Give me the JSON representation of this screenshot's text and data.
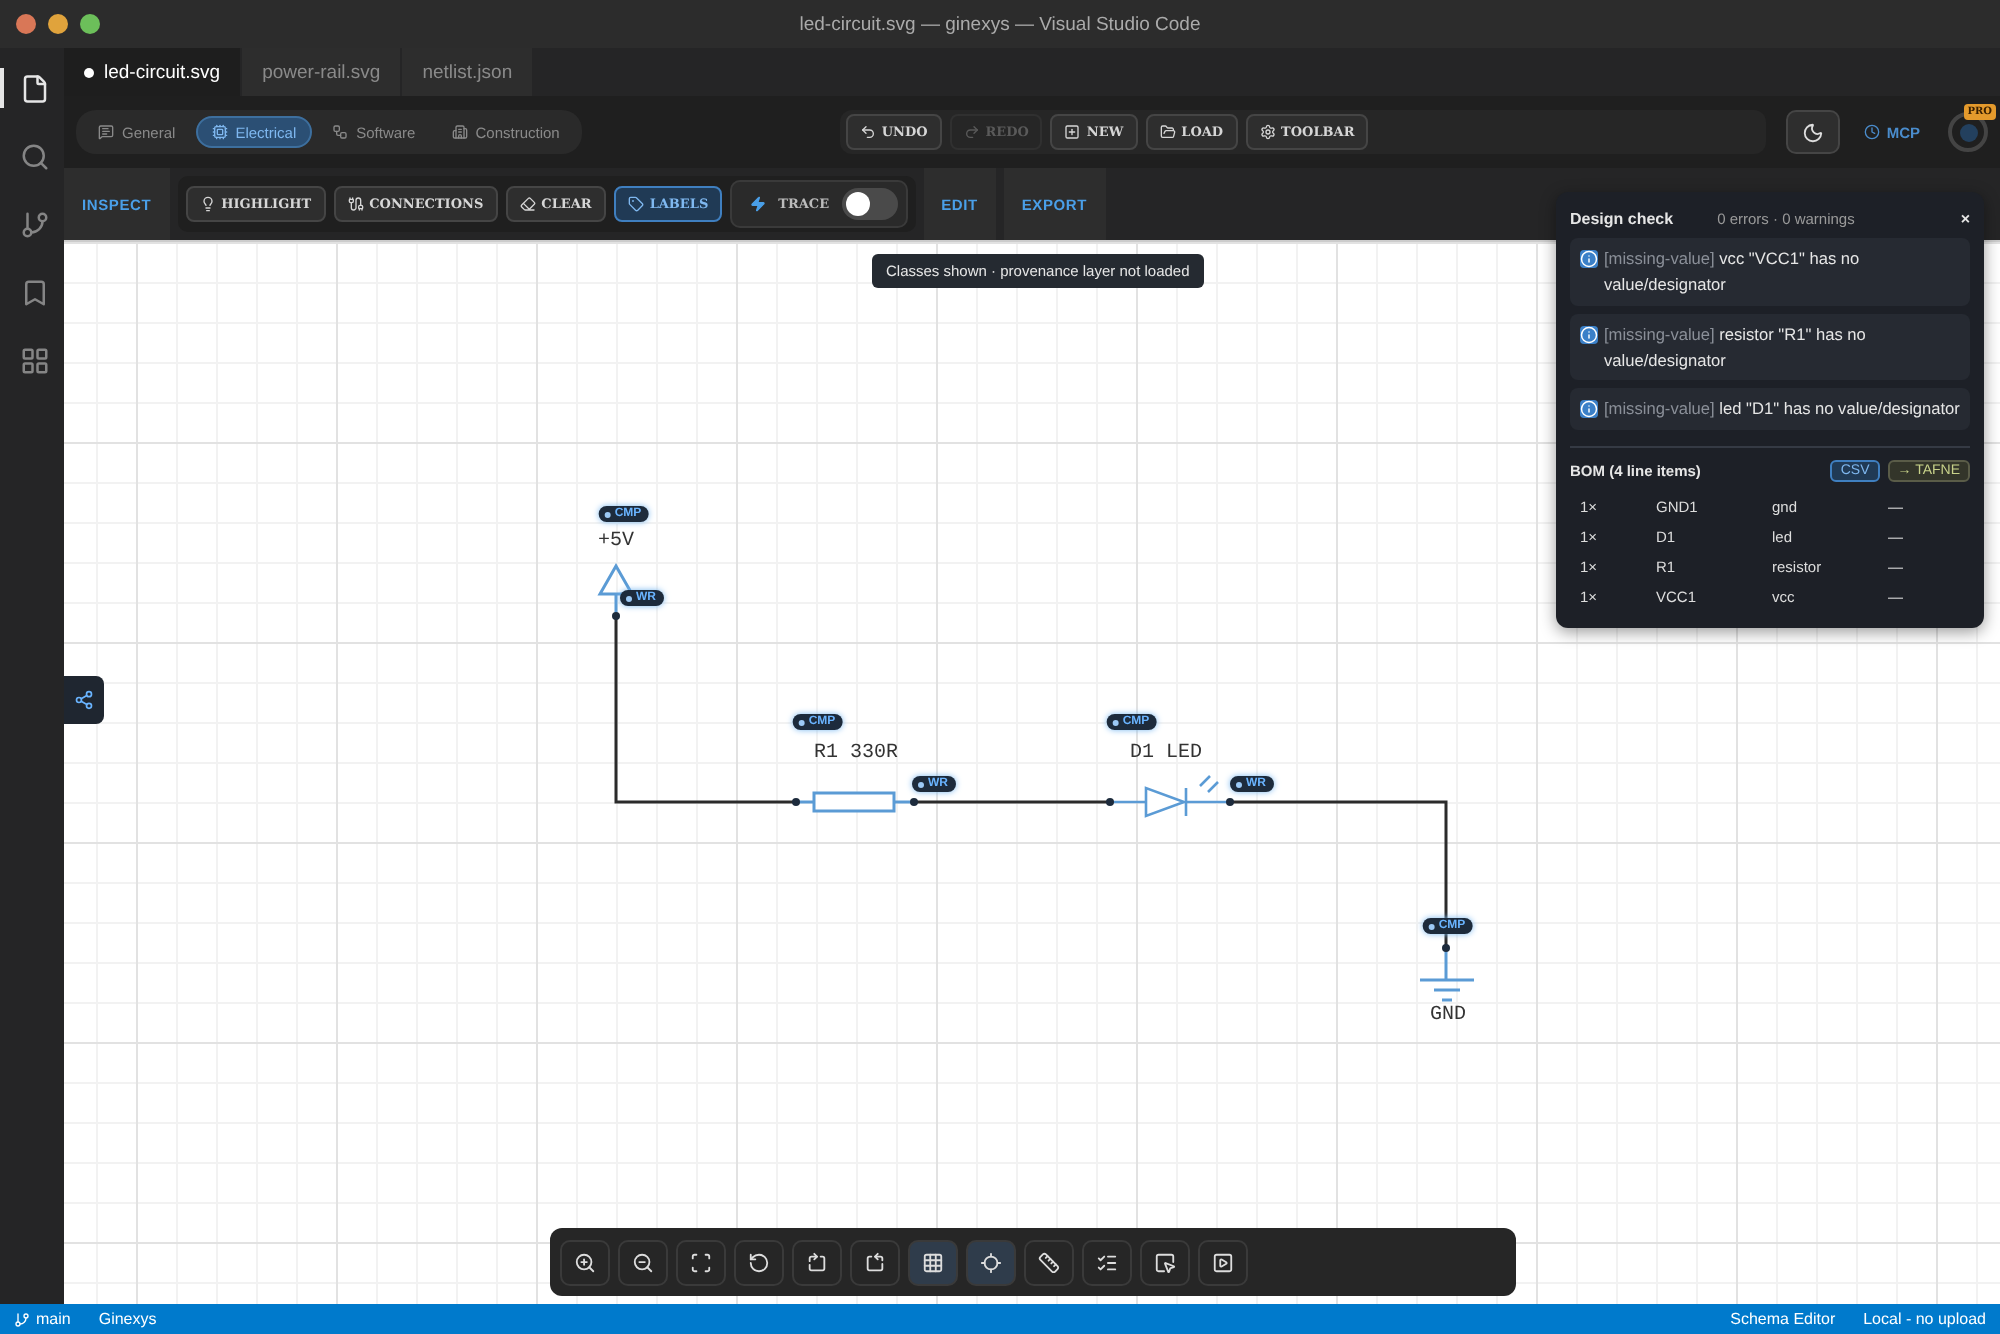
{
  "window": {
    "title": "led-circuit.svg — ginexys — Visual Studio Code"
  },
  "activity_bar": [
    {
      "kind": "files",
      "selected": true
    },
    {
      "kind": "search",
      "selected": false
    },
    {
      "kind": "source-control",
      "selected": false
    },
    {
      "kind": "bookmarks",
      "selected": false
    },
    {
      "kind": "extensions",
      "selected": false
    }
  ],
  "tabs": [
    {
      "label": "led-circuit.svg",
      "selected": true,
      "modified": true
    },
    {
      "label": "power-rail.svg",
      "selected": false,
      "modified": false
    },
    {
      "label": "netlist.json",
      "selected": false,
      "modified": false
    }
  ],
  "categories": [
    {
      "kind": "general",
      "label": "General",
      "selected": false
    },
    {
      "kind": "electrical",
      "label": "Electrical",
      "selected": true
    },
    {
      "kind": "software",
      "label": "Software",
      "selected": false
    },
    {
      "kind": "construction",
      "label": "Construction",
      "selected": false
    }
  ],
  "actions": [
    {
      "kind": "undo",
      "label": "UNDO",
      "disabled": false
    },
    {
      "kind": "redo",
      "label": "REDO",
      "disabled": true
    },
    {
      "kind": "new",
      "label": "NEW",
      "disabled": false
    },
    {
      "kind": "load",
      "label": "LOAD",
      "disabled": false
    },
    {
      "kind": "toolbar",
      "label": "TOOLBAR",
      "disabled": false
    }
  ],
  "mcp": {
    "label": "MCP"
  },
  "avatar": {
    "badge": "PRO"
  },
  "sections": [
    {
      "label": "INSPECT"
    },
    {
      "label": "EDIT"
    },
    {
      "label": "EXPORT"
    }
  ],
  "inspect_tools": [
    {
      "kind": "highlight",
      "label": "HIGHLIGHT",
      "selected": false
    },
    {
      "kind": "connections",
      "label": "CONNECTIONS",
      "selected": false
    },
    {
      "kind": "clear",
      "label": "CLEAR",
      "selected": false
    },
    {
      "kind": "labels",
      "label": "LABELS",
      "selected": true
    }
  ],
  "trace": {
    "label": "TRACE",
    "on": false
  },
  "tooltip": "Classes shown · provenance layer not loaded",
  "schematic": {
    "components": [
      {
        "kind": "supply",
        "label": "+5V",
        "badge": "CMP"
      },
      {
        "kind": "resistor",
        "label": "R1 330R",
        "badge": "CMP"
      },
      {
        "kind": "led",
        "label": "D1 LED",
        "badge": "CMP"
      },
      {
        "kind": "ground",
        "label": "GND",
        "badge": "CMP"
      }
    ],
    "wire_badges": [
      "WR",
      "WR",
      "WR"
    ]
  },
  "design_check": {
    "title": "Design check",
    "summary": "0 errors · 0 warnings",
    "close": "×",
    "issues": [
      {
        "tag": "[missing-value]",
        "message": "vcc \"VCC1\" has no value/designator"
      },
      {
        "tag": "[missing-value]",
        "message": "resistor \"R1\" has no value/designator"
      },
      {
        "tag": "[missing-value]",
        "message": "led \"D1\" has no value/designator"
      }
    ],
    "bom": {
      "title": "BOM (4 line items)",
      "buttons": [
        {
          "kind": "csv",
          "label": "CSV"
        },
        {
          "kind": "tafne",
          "label": "→ TAFNE"
        }
      ],
      "rows": [
        {
          "qty": "1×",
          "ref": "GND1",
          "type": "gnd",
          "value": "—"
        },
        {
          "qty": "1×",
          "ref": "D1",
          "type": "led",
          "value": "—"
        },
        {
          "qty": "1×",
          "ref": "R1",
          "type": "resistor",
          "value": "—"
        },
        {
          "qty": "1×",
          "ref": "VCC1",
          "type": "vcc",
          "value": "—"
        }
      ]
    }
  },
  "canvas_tools": [
    {
      "kind": "zoom-in",
      "selected": false
    },
    {
      "kind": "zoom-out",
      "selected": false
    },
    {
      "kind": "fit",
      "selected": false
    },
    {
      "kind": "rotate-free",
      "selected": false
    },
    {
      "kind": "rotate-cw",
      "selected": false
    },
    {
      "kind": "rotate-ccw",
      "selected": false
    },
    {
      "kind": "grid",
      "selected": true
    },
    {
      "kind": "snap",
      "selected": true
    },
    {
      "kind": "ruler",
      "selected": false
    },
    {
      "kind": "checks",
      "selected": false
    },
    {
      "kind": "select",
      "selected": false
    },
    {
      "kind": "play",
      "selected": false
    }
  ],
  "status_bar": {
    "branch": "main",
    "project": "Ginexys",
    "mode": "Schema Editor",
    "sync": "Local - no upload"
  }
}
